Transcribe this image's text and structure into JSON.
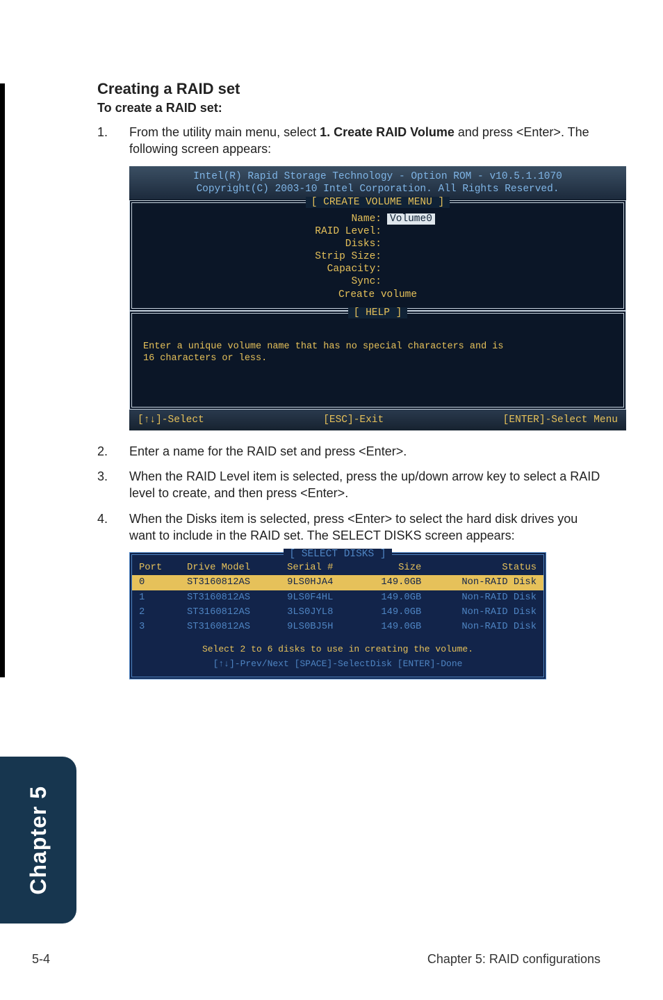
{
  "heading": "Creating a RAID set",
  "subheading": "To create a RAID set:",
  "steps": [
    {
      "n": "1.",
      "t_pre": "From the utility main menu, select ",
      "t_bold": "1. Create RAID Volume",
      "t_post": " and press <Enter>. The following screen appears:"
    },
    {
      "n": "2.",
      "t_pre": "Enter a name for the RAID set and press <Enter>.",
      "t_bold": "",
      "t_post": ""
    },
    {
      "n": "3.",
      "t_pre": "When the RAID Level item is selected, press the up/down arrow key to select a RAID level to create, and then press <Enter>.",
      "t_bold": "",
      "t_post": ""
    },
    {
      "n": "4.",
      "t_pre": "When the Disks item is selected, press <Enter> to select the hard disk drives you want to include in the RAID set. The SELECT DISKS screen appears:",
      "t_bold": "",
      "t_post": ""
    }
  ],
  "console1": {
    "head1": "Intel(R) Rapid Storage Technology - Option ROM - v10.5.1.1070",
    "head2": "Copyright(C) 2003-10 Intel Corporation.  All Rights Reserved.",
    "sect1_title": "[ CREATE VOLUME MENU ]",
    "fields": [
      {
        "label": "Name:",
        "val": "Volume0",
        "hl": true
      },
      {
        "label": "RAID Level:",
        "val": ""
      },
      {
        "label": "Disks:",
        "val": ""
      },
      {
        "label": "Strip Size:",
        "val": ""
      },
      {
        "label": "Capacity:",
        "val": ""
      },
      {
        "label": "Sync:",
        "val": ""
      },
      {
        "label": "Create volume",
        "val": "",
        "center": true
      }
    ],
    "sect2_title": "[ HELP ]",
    "help_l1": "Enter a unique volume name that has no special characters and is",
    "help_l2": "16 characters or less.",
    "foot_left": "[↑↓]-Select",
    "foot_mid": "[ESC]-Exit",
    "foot_right": "[ENTER]-Select Menu"
  },
  "console2": {
    "title": "[ SELECT DISKS ]",
    "header": [
      "Port",
      "Drive Model",
      "Serial #",
      "Size",
      "Status"
    ],
    "rows": [
      {
        "hl": true,
        "c": [
          "0",
          "ST3160812AS",
          "9LS0HJA4",
          "149.0GB",
          "Non-RAID Disk"
        ]
      },
      {
        "hl": false,
        "c": [
          "1",
          "ST3160812AS",
          "9LS0F4HL",
          "149.0GB",
          "Non-RAID Disk"
        ]
      },
      {
        "hl": false,
        "c": [
          "2",
          "ST3160812AS",
          "3LS0JYL8",
          "149.0GB",
          "Non-RAID Disk"
        ]
      },
      {
        "hl": false,
        "c": [
          "3",
          "ST3160812AS",
          "9LS0BJ5H",
          "149.0GB",
          "Non-RAID Disk"
        ]
      }
    ],
    "foot1": "Select 2 to 6 disks to use in creating the volume.",
    "foot2": "[↑↓]-Prev/Next [SPACE]-SelectDisk [ENTER]-Done"
  },
  "sidebar": "Chapter 5",
  "pagefoot_left": "5-4",
  "pagefoot_right": "Chapter 5: RAID configurations",
  "chart_data": {
    "type": "table",
    "title": "SELECT DISKS",
    "columns": [
      "Port",
      "Drive Model",
      "Serial #",
      "Size",
      "Status"
    ],
    "rows": [
      [
        "0",
        "ST3160812AS",
        "9LS0HJA4",
        "149.0GB",
        "Non-RAID Disk"
      ],
      [
        "1",
        "ST3160812AS",
        "9LS0F4HL",
        "149.0GB",
        "Non-RAID Disk"
      ],
      [
        "2",
        "ST3160812AS",
        "3LS0JYL8",
        "149.0GB",
        "Non-RAID Disk"
      ],
      [
        "3",
        "ST3160812AS",
        "9LS0BJ5H",
        "149.0GB",
        "Non-RAID Disk"
      ]
    ]
  }
}
